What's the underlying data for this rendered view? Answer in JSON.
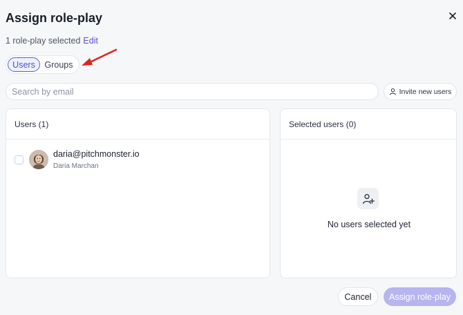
{
  "dialog": {
    "title": "Assign role-play",
    "close_icon": "close-icon",
    "summary_text": "1 role-play selected",
    "edit_link": "Edit"
  },
  "tabs": [
    {
      "label": "Users",
      "active": true
    },
    {
      "label": "Groups",
      "active": false
    }
  ],
  "search": {
    "placeholder": "Search by email",
    "value": ""
  },
  "invite_button": {
    "label": "Invite new users",
    "icon": "user-icon"
  },
  "users_panel": {
    "header": "Users (1)",
    "users": [
      {
        "email": "daria@pitchmonster.io",
        "name": "Daria Marchan",
        "checked": false
      }
    ]
  },
  "selected_panel": {
    "header": "Selected users (0)",
    "empty_icon": "user-plus-icon",
    "empty_text": "No users selected yet"
  },
  "footer": {
    "cancel_label": "Cancel",
    "assign_label": "Assign role-play"
  },
  "colors": {
    "accent": "#5a4fd6",
    "assign_disabled": "#b6b5f0",
    "annotation_arrow": "#e0231c"
  }
}
